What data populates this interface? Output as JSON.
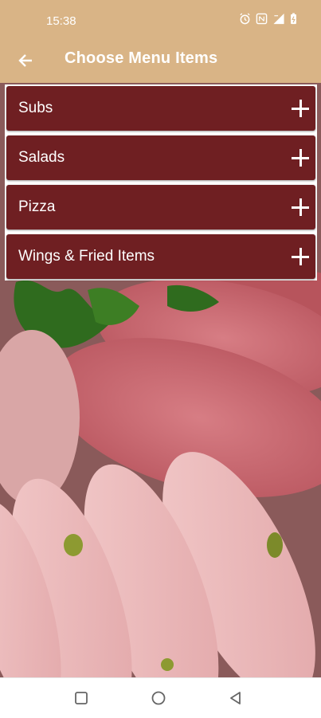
{
  "status_bar": {
    "time": "15:38",
    "icons": [
      "alarm-icon",
      "nfc-icon",
      "signal-icon",
      "battery-icon"
    ]
  },
  "app_bar": {
    "title": "Choose Menu Items",
    "back_icon": "arrow-left-icon"
  },
  "menu": {
    "items": [
      {
        "label": "Subs",
        "icon": "plus-icon"
      },
      {
        "label": "Salads",
        "icon": "plus-icon"
      },
      {
        "label": "Pizza",
        "icon": "plus-icon"
      },
      {
        "label": "Wings & Fried Items",
        "icon": "plus-icon"
      }
    ]
  },
  "nav_bar": {
    "buttons": [
      "recents-square-icon",
      "home-circle-icon",
      "back-triangle-icon"
    ]
  },
  "colors": {
    "app_bar": "#d9b486",
    "menu_item_bg": "#6f1f22",
    "text_on_dark": "#ffffff"
  }
}
